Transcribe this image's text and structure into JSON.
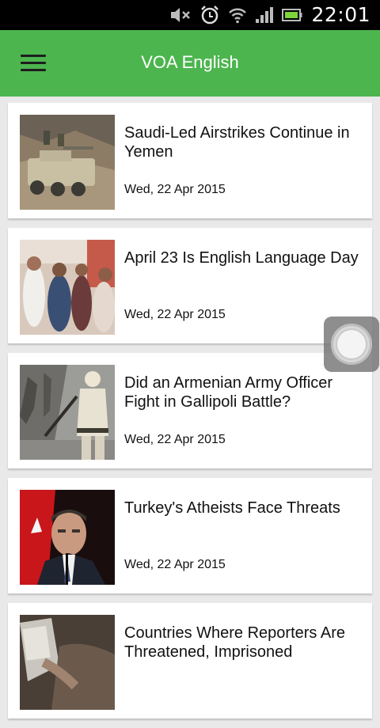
{
  "status_bar": {
    "time": "22:01",
    "icons": [
      "mute-icon",
      "alarm-icon",
      "wifi-icon",
      "signal-icon",
      "battery-icon"
    ]
  },
  "app_bar": {
    "title": "VOA English",
    "menu_icon": "hamburger-menu-icon",
    "color": "#4cb54e"
  },
  "articles": [
    {
      "headline": "Saudi-Led Airstrikes Continue in Yemen",
      "date": "Wed, 22 Apr 2015"
    },
    {
      "headline": "April 23 Is English Language Day",
      "date": "Wed, 22 Apr 2015"
    },
    {
      "headline": "Did an Armenian Army Officer Fight in Gallipoli Battle?",
      "date": "Wed, 22 Apr 2015"
    },
    {
      "headline": "Turkey's Atheists Face Threats",
      "date": "Wed, 22 Apr 2015"
    },
    {
      "headline": "Countries Where Reporters Are Threatened, Imprisoned",
      "date": ""
    }
  ],
  "floating_button": {
    "icon": "assistive-touch-icon"
  }
}
